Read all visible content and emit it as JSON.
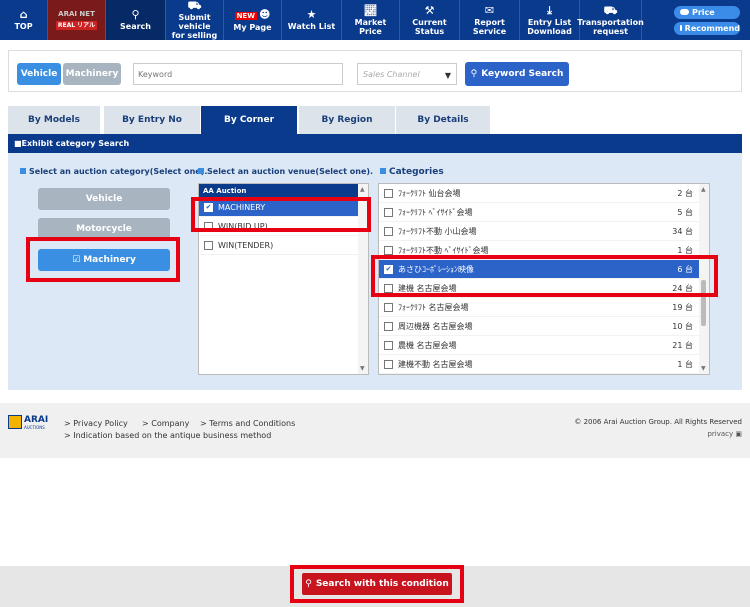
{
  "nav": {
    "top": "TOP",
    "logo_line1": "ARAI NET",
    "logo_line2": "REAL リアル",
    "search": "Search",
    "submit_line1": "Submit vehicle",
    "submit_line2": "for selling",
    "new_badge": "NEW",
    "mypage": "My Page",
    "watch": "Watch List",
    "market": "Market Price",
    "current_line1": "Current",
    "current_line2": "Status",
    "report_line1": "Report",
    "report_line2": "Service",
    "entry_line1": "Entry List",
    "entry_line2": "Download",
    "transport_line1": "Transportation",
    "transport_line2": "request",
    "pill_price": "Price",
    "pill_recommend": "Recommend"
  },
  "search": {
    "vehicle": "Vehicle",
    "machinery": "Machinery",
    "keyword_placeholder": "Keyword",
    "sales_channel": "Sales Channel",
    "keyword_button": "Keyword Search"
  },
  "tabs": [
    "By Models",
    "By Entry No",
    "By Corner",
    "By Region",
    "By Details"
  ],
  "strip": "■Exhibit category Search",
  "category_col": {
    "heading": "Select an auction category(Select one).",
    "buttons": [
      "Vehicle",
      "Motorcycle",
      "Machinery"
    ]
  },
  "venue_col": {
    "heading": "Select an auction venue(Select one).",
    "list_head": "AA Auction",
    "items": [
      "MACHINERY",
      "WIN(BID UP)",
      "WIN(TENDER)"
    ]
  },
  "cat_col": {
    "heading": "Categories",
    "items": [
      {
        "name": "ﾌｫｰｸﾘﾌﾄ 仙台会場",
        "count": "2 台"
      },
      {
        "name": "ﾌｫｰｸﾘﾌﾄ ﾍﾞｲｻｲﾄﾞ会場",
        "count": "5 台"
      },
      {
        "name": "ﾌｫｰｸﾘﾌﾄ不動 小山会場",
        "count": "34 台"
      },
      {
        "name": "ﾌｫｰｸﾘﾌﾄ不動 ﾍﾞｲｻｲﾄﾞ会場",
        "count": "1 台"
      },
      {
        "name": "あさひｺｰﾎﾟﾚｰｼｮﾝ映像",
        "count": "6 台"
      },
      {
        "name": "建機 名古屋会場",
        "count": "24 台"
      },
      {
        "name": "ﾌｫｰｸﾘﾌﾄ 名古屋会場",
        "count": "19 台"
      },
      {
        "name": "周辺機器 名古屋会場",
        "count": "10 台"
      },
      {
        "name": "農機 名古屋会場",
        "count": "21 台"
      },
      {
        "name": "建機不動 名古屋会場",
        "count": "1 台"
      }
    ]
  },
  "footer": {
    "logo": "ARAI",
    "logo_sub": "AUCTIONS",
    "privacy": "> Privacy Policy",
    "company": "> Company",
    "terms": "> Terms and Conditions",
    "indication": "> Indication based on the antique business method",
    "copyright": "© 2006 Arai Auction Group. All Rights Reserved",
    "privacy_mark": "privacy"
  },
  "bottom": {
    "button": "Search with this condition"
  }
}
